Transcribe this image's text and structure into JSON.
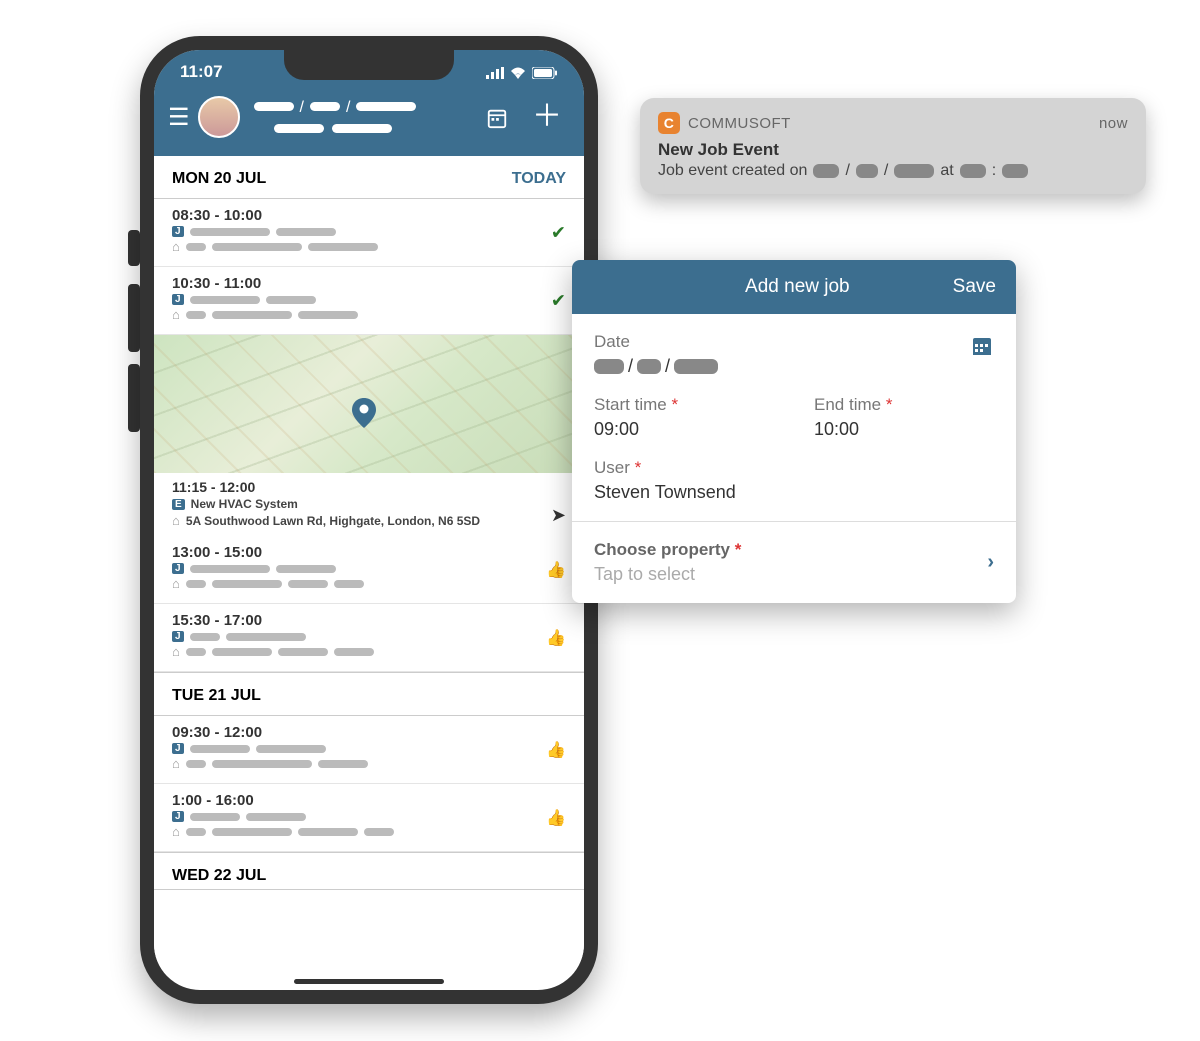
{
  "status_bar": {
    "time": "11:07"
  },
  "day1": {
    "label": "MON 20 JUL",
    "today": "TODAY"
  },
  "day2": {
    "label": "TUE 21 JUL"
  },
  "day3": {
    "label": "WED 22 JUL"
  },
  "ev": [
    {
      "time": "08:30 - 10:00"
    },
    {
      "time": "10:30 - 11:00"
    },
    {
      "time": "11:15 - 12:00",
      "title": "New HVAC System",
      "addr": "5A Southwood Lawn Rd, Highgate, London, N6 5SD"
    },
    {
      "time": "13:00 - 15:00"
    },
    {
      "time": "15:30 - 17:00"
    },
    {
      "time": "09:30 - 12:00"
    },
    {
      "time": "1:00 - 16:00"
    }
  ],
  "notif": {
    "app": "COMMUSOFT",
    "when": "now",
    "title": "New Job Event",
    "prefix": "Job event created on",
    "at": "at"
  },
  "modal": {
    "title": "Add new job",
    "save": "Save",
    "date_lbl": "Date",
    "start_lbl": "Start time",
    "start_val": "09:00",
    "end_lbl": "End time",
    "end_val": "10:00",
    "user_lbl": "User",
    "user_val": "Steven Townsend",
    "prop_lbl": "Choose property",
    "tap": "Tap to select"
  },
  "badge": {
    "j": "J",
    "e": "E"
  }
}
